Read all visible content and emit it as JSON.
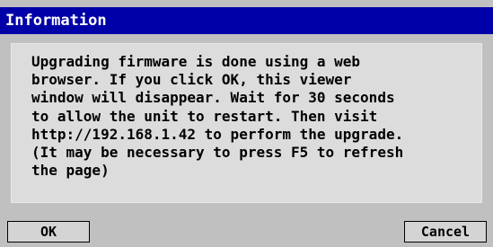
{
  "dialog": {
    "title": "Information",
    "message_lines": [
      "Upgrading firmware is done using a web",
      "browser. If you click OK, this viewer",
      "window will disappear. Wait for 30 seconds",
      "to allow the unit to restart. Then visit",
      "http://192.168.1.42 to perform the upgrade.",
      "(It may be necessary to press F5 to refresh",
      "the page)"
    ],
    "ok_label": "OK",
    "cancel_label": "Cancel"
  },
  "colors": {
    "titlebar": "#0000a8",
    "background": "#c0c0c0",
    "message_background": "#dcdcdc"
  }
}
